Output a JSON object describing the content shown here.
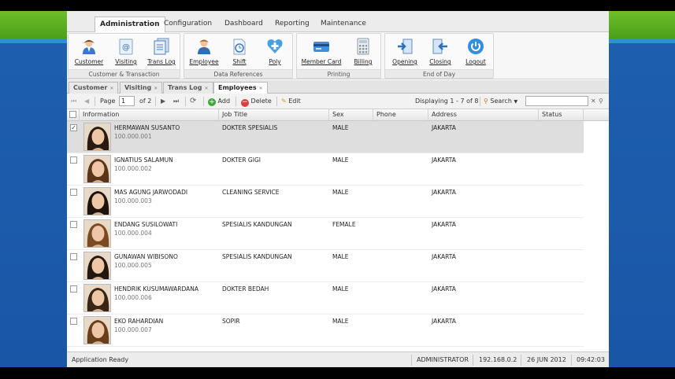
{
  "menu": {
    "tabs": [
      {
        "label": "Administration"
      },
      {
        "label": "Configuration"
      },
      {
        "label": "Dashboard"
      },
      {
        "label": "Reporting"
      },
      {
        "label": "Maintenance"
      }
    ]
  },
  "ribbon": {
    "groups": [
      {
        "title": "Customer & Transaction",
        "buttons": [
          {
            "label": "Customer",
            "icon": "customer-icon"
          },
          {
            "label": "Visiting",
            "icon": "visiting-icon"
          },
          {
            "label": "Trans Log",
            "icon": "trans-log-icon"
          }
        ]
      },
      {
        "title": "Data References",
        "buttons": [
          {
            "label": "Employee",
            "icon": "employee-icon"
          },
          {
            "label": "Shift",
            "icon": "shift-icon"
          },
          {
            "label": "Poly",
            "icon": "poly-icon"
          }
        ]
      },
      {
        "title": "Printing",
        "buttons": [
          {
            "label": "Member Card",
            "icon": "member-card-icon"
          },
          {
            "label": "Billing",
            "icon": "billing-icon"
          }
        ]
      },
      {
        "title": "End of Day",
        "buttons": [
          {
            "label": "Opening",
            "icon": "opening-icon"
          },
          {
            "label": "Closing",
            "icon": "closing-icon"
          },
          {
            "label": "Logout",
            "icon": "power-icon"
          }
        ]
      }
    ]
  },
  "subtabs": [
    {
      "label": "Customer"
    },
    {
      "label": "Visiting"
    },
    {
      "label": "Trans Log"
    },
    {
      "label": "Employees"
    }
  ],
  "toolbar": {
    "page_label": "Page",
    "page_value": "1",
    "of_label": "of 2",
    "add_label": "Add",
    "delete_label": "Delete",
    "edit_label": "Edit",
    "displaying": "Displaying 1 - 7 of 8",
    "search_label": "Search"
  },
  "grid": {
    "columns": [
      "Information",
      "Job Title",
      "Sex",
      "Phone",
      "Address",
      "Status"
    ],
    "rows": [
      {
        "name": "HERMAWAN SUSANTO",
        "id": "100.000.001",
        "job": "DOKTER SPESIALIS",
        "sex": "MALE",
        "phone": "",
        "address": "JAKARTA",
        "status": "",
        "checked": true
      },
      {
        "name": "IGNATIUS SALAMUN",
        "id": "100.000.002",
        "job": "DOKTER GIGI",
        "sex": "MALE",
        "phone": "",
        "address": "JAKARTA",
        "status": "",
        "checked": false
      },
      {
        "name": "MAS AGUNG JARWODADI",
        "id": "100.000.003",
        "job": "CLEANING SERVICE",
        "sex": "MALE",
        "phone": "",
        "address": "JAKARTA",
        "status": "",
        "checked": false
      },
      {
        "name": "ENDANG SUSILOWATI",
        "id": "100.000.004",
        "job": "SPESIALIS KANDUNGAN",
        "sex": "FEMALE",
        "phone": "",
        "address": "JAKARTA",
        "status": "",
        "checked": false
      },
      {
        "name": "GUNAWAN WIBISONO",
        "id": "100.000.005",
        "job": "SPESIALIS KANDUNGAN",
        "sex": "MALE",
        "phone": "",
        "address": "JAKARTA",
        "status": "",
        "checked": false
      },
      {
        "name": "HENDRIK KUSUMAWARDANA",
        "id": "100.000.006",
        "job": "DOKTER BEDAH",
        "sex": "MALE",
        "phone": "",
        "address": "JAKARTA",
        "status": "",
        "checked": false
      },
      {
        "name": "EKO RAHARDIAN",
        "id": "100.000.007",
        "job": "SOPIR",
        "sex": "MALE",
        "phone": "",
        "address": "JAKARTA",
        "status": "",
        "checked": false
      }
    ]
  },
  "status": {
    "message": "Application Ready",
    "user": "ADMINISTRATOR",
    "ip": "192.168.0.2",
    "date": "26 JUN 2012",
    "time": "09:42:03"
  },
  "colors": {
    "brand_green": "#5aae20",
    "backdrop_blue": "#1e5fb0",
    "selected_row": "#dedede"
  }
}
